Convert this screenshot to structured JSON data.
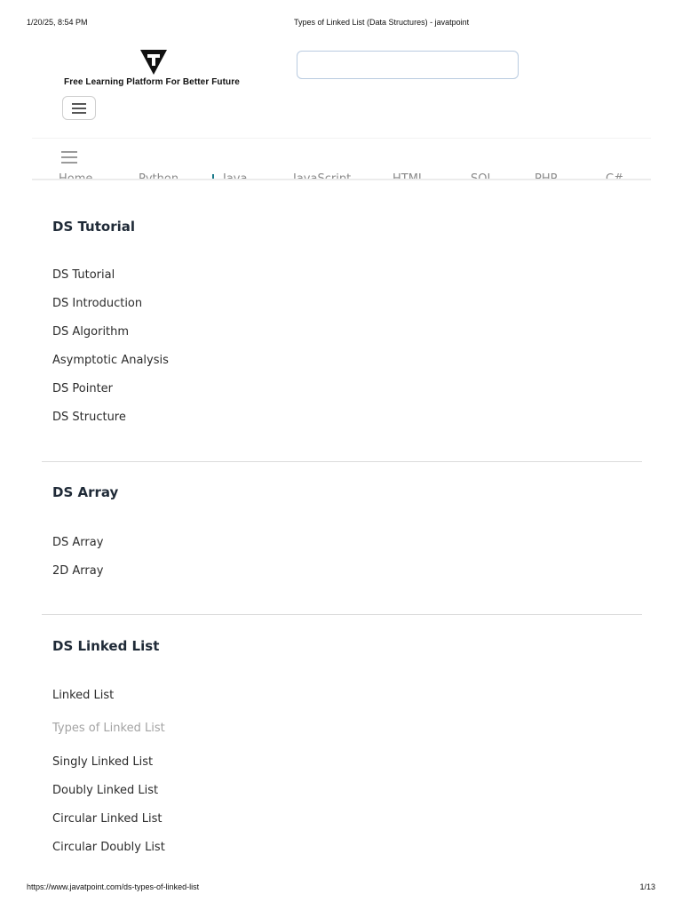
{
  "print_header": {
    "datetime": "1/20/25, 8:54 PM",
    "title": "Types of Linked List (Data Structures) - javatpoint"
  },
  "print_footer": {
    "url": "https://www.javatpoint.com/ds-types-of-linked-list",
    "page": "1/13"
  },
  "site": {
    "tagline": "Free Learning Platform For Better Future",
    "search_placeholder": ""
  },
  "nav": {
    "items": [
      "Home",
      "Python",
      "Java",
      "JavaScript",
      "HTML",
      "SQL",
      "PHP",
      "C#"
    ]
  },
  "sidebar": {
    "sections": [
      {
        "title": "DS Tutorial",
        "links": [
          "DS Tutorial",
          "DS Introduction",
          "DS Algorithm",
          "Asymptotic Analysis",
          "DS Pointer",
          "DS Structure"
        ]
      },
      {
        "title": "DS Array",
        "links": [
          "DS Array",
          "2D Array"
        ]
      },
      {
        "title": "DS Linked List",
        "links": [
          "Linked List",
          "Types of Linked List",
          "Singly Linked List",
          "Doubly Linked List",
          "Circular Linked List",
          "Circular Doubly List"
        ]
      }
    ],
    "active_link": "Types of Linked List"
  },
  "colors": {
    "active_link": "#a3a3a3",
    "heading": "#1f2a37",
    "nav_text": "#8a8a8a"
  },
  "icons": {
    "logo": "javatpoint-t-logo",
    "menu": "hamburger-icon"
  }
}
